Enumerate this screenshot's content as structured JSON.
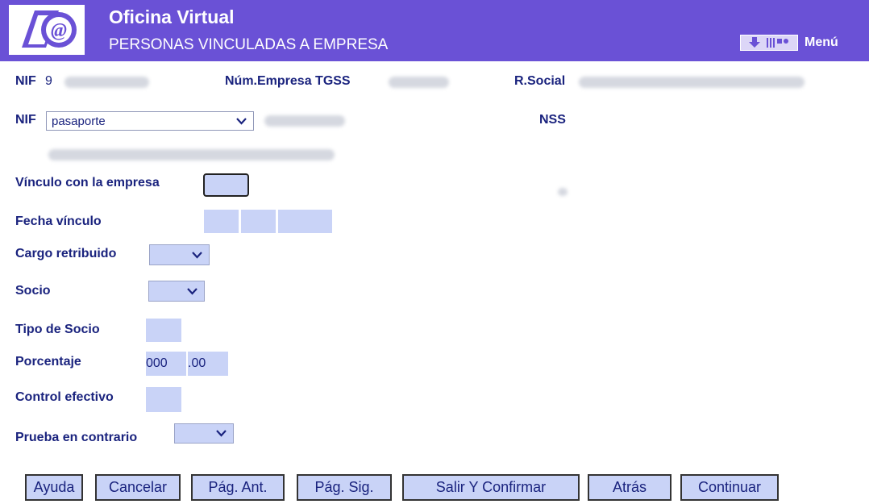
{
  "header": {
    "title": "Oficina Virtual",
    "subtitle": "PERSONAS VINCULADAS A EMPRESA",
    "menu_label": "Menú",
    "logo_text": "@"
  },
  "info": {
    "nif_label": "NIF",
    "nif_prefix": "9",
    "num_empresa_label": "Núm.Empresa TGSS",
    "rsocial_label": "R.Social"
  },
  "form": {
    "nif_label": "NIF",
    "doc_type_selected": "pasaporte",
    "nss_label": "NSS",
    "vinculo_label": "Vínculo con la empresa",
    "fecha_label": "Fecha vínculo",
    "cargo_label": "Cargo retribuido",
    "socio_label": "Socio",
    "tipo_socio_label": "Tipo de Socio",
    "porcentaje_label": "Porcentaje",
    "porcentaje_int": "000",
    "porcentaje_dec": ".00",
    "control_label": "Control efectivo",
    "prueba_label": "Prueba en contrario"
  },
  "buttons": {
    "ayuda": "Ayuda",
    "cancelar": "Cancelar",
    "pag_ant": "Pág. Ant.",
    "pag_sig": "Pág. Sig.",
    "salir": "Salir Y Confirmar",
    "atras": "Atrás",
    "continuar": "Continuar"
  },
  "colors": {
    "header_bg": "#6a51d6",
    "field_bg": "#c9d3f7",
    "label_text": "#1a237e"
  }
}
